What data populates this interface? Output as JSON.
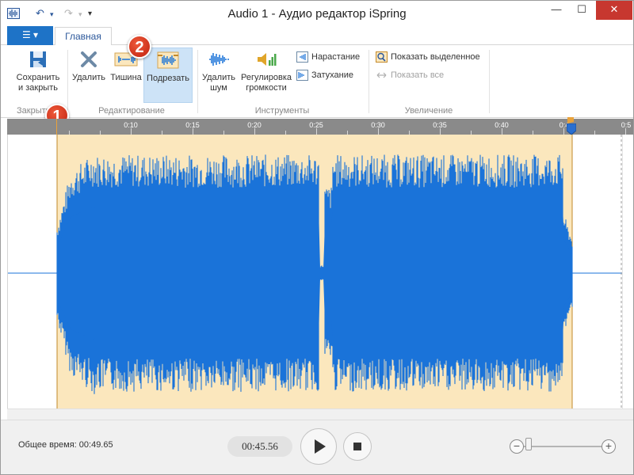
{
  "titlebar": {
    "title": "Audio 1 - Аудио редактор iSpring",
    "undo_icon": "undo-icon",
    "redo_icon": "redo-icon",
    "minimize": "—",
    "maximize": "☐",
    "close": "✕"
  },
  "ribbon": {
    "file_menu": "☰ ▾",
    "tab_main": "Главная",
    "close_group": {
      "label": "Закрыть",
      "save_close": [
        "Сохранить",
        "и закрыть"
      ]
    },
    "edit_group": {
      "label": "Редактирование",
      "delete": "Удалить",
      "silence": "Тишина",
      "trim": "Подрезать"
    },
    "tools_group": {
      "label": "Инструменты",
      "denoise": [
        "Удалить",
        "шум"
      ],
      "volume": [
        "Регулировка",
        "громкости"
      ],
      "fade_in": "Нарастание",
      "fade_out": "Затухание"
    },
    "zoom_group": {
      "label": "Увеличение",
      "show_selected": "Показать выделенное",
      "show_all": "Показать все"
    }
  },
  "callouts": {
    "one": "1",
    "two": "2"
  },
  "timeline": {
    "ticks": [
      "0:10",
      "0:15",
      "0:20",
      "0:25",
      "0:30",
      "0:35",
      "0:40",
      "0:4",
      "0:5"
    ]
  },
  "player": {
    "total_time": "Общее время: 00:49.65",
    "current_time": "00:45.56"
  },
  "colors": {
    "accent": "#1e73c7",
    "waveform": "#1a73d9",
    "selection": "#fbe7bd",
    "ruler": "#8a8a8a",
    "callout": "#d8321a"
  }
}
